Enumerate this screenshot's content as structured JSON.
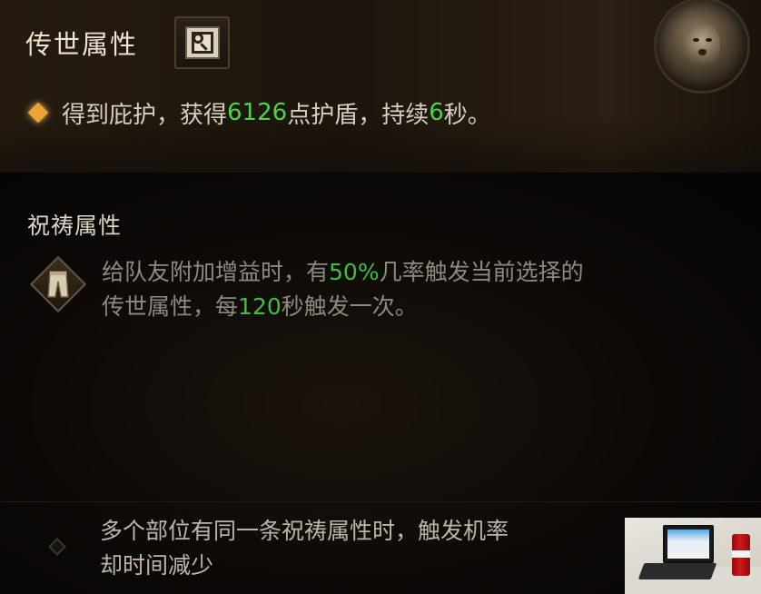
{
  "legendary": {
    "title": "传世属性",
    "effect": {
      "prefix": "得到庇护，获得",
      "shield_value": "6126",
      "middle": "点护盾，持续",
      "duration": "6",
      "suffix": "秒。"
    }
  },
  "prayer": {
    "title": "祝祷属性",
    "desc": {
      "part1": "给队友附加增益时，有",
      "chance": "50%",
      "part2": "几率触发当前选择的",
      "part3": "传世属性，每",
      "cooldown": "120",
      "part4": "秒触发一次。"
    }
  },
  "note": {
    "line1": "多个部位有同一条祝祷属性时，触发机率",
    "line2": "却时间减少"
  },
  "icons": {
    "codex": "codex-magnifier-icon",
    "lion": "lion-crest-icon",
    "pants": "pants-item-icon",
    "effect_bullet": "gold-diamond-icon",
    "note_bullet": "diamond-bullet-icon"
  },
  "colors": {
    "highlight": "#4fd24a",
    "gold_bullet": "#e8a43a"
  }
}
